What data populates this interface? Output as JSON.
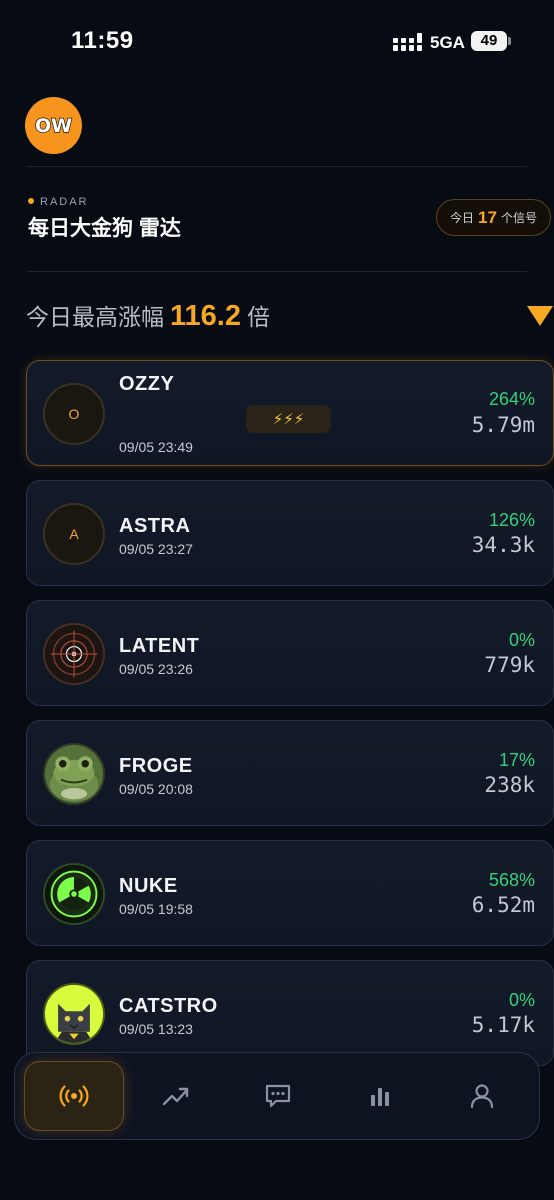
{
  "status_bar": {
    "time": "11:59",
    "network": "5GA",
    "battery": "49"
  },
  "app": {
    "logo_text": "OW"
  },
  "header": {
    "tag": "RADAR",
    "title": "每日大金狗 雷达",
    "signal_prefix": "今日",
    "signal_count": "17",
    "signal_suffix": "个信号"
  },
  "headline": {
    "label": "今日最高涨幅",
    "value": "116.2",
    "unit": "倍"
  },
  "tokens": [
    {
      "name": "OZZY",
      "time": "09/05 23:49",
      "pct": "264%",
      "mcap": "5.79m",
      "avatar": "O",
      "bolts": "⚡⚡⚡"
    },
    {
      "name": "ASTRA",
      "time": "09/05 23:27",
      "pct": "126%",
      "mcap": "34.3k",
      "avatar": "A"
    },
    {
      "name": "LATENT",
      "time": "09/05 23:26",
      "pct": "0%",
      "mcap": "779k"
    },
    {
      "name": "FROGE",
      "time": "09/05 20:08",
      "pct": "17%",
      "mcap": "238k"
    },
    {
      "name": "NUKE",
      "time": "09/05 19:58",
      "pct": "568%",
      "mcap": "6.52m"
    },
    {
      "name": "CATSTRO",
      "time": "09/05 13:23",
      "pct": "0%",
      "mcap": "5.17k"
    }
  ],
  "colors": {
    "accent": "#f7a823",
    "positive": "#34d07a",
    "background": "#070b14"
  },
  "tabs": [
    "radar-icon",
    "trend-icon",
    "chat-icon",
    "stats-icon",
    "profile-icon"
  ]
}
